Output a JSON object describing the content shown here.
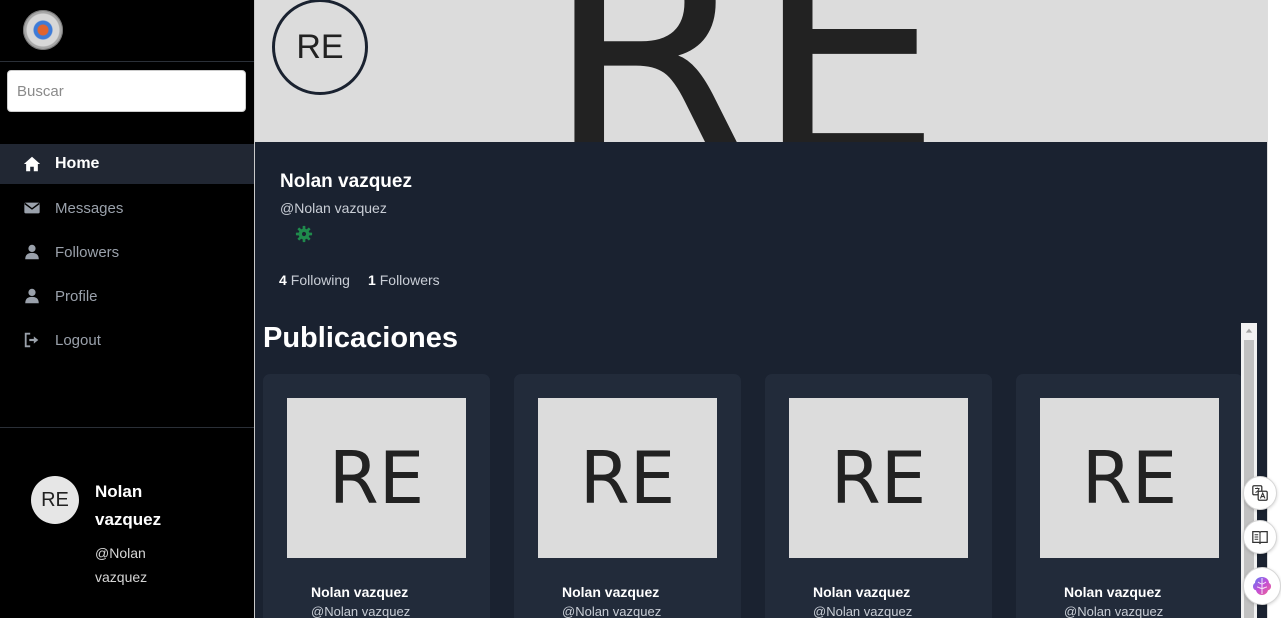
{
  "sidebar": {
    "search_placeholder": "Buscar",
    "nav": [
      {
        "label": "Home",
        "icon": "home-icon"
      },
      {
        "label": "Messages",
        "icon": "envelope-icon"
      },
      {
        "label": "Followers",
        "icon": "user-icon"
      },
      {
        "label": "Profile",
        "icon": "user-icon"
      },
      {
        "label": "Logout",
        "icon": "logout-icon"
      }
    ],
    "user": {
      "initials": "RE",
      "name": "Nolan vazquez",
      "handle": "@Nolan vazquez"
    }
  },
  "profile": {
    "cover_text": "RE",
    "avatar_initials": "RE",
    "name": "Nolan vazquez",
    "handle": "@Nolan vazquez",
    "following_count": "4",
    "following_label": "Following",
    "followers_count": "1",
    "followers_label": "Followers"
  },
  "posts": {
    "title": "Publicaciones",
    "items": [
      {
        "image_text": "RE",
        "name": "Nolan vazquez",
        "handle": "@Nolan vazquez"
      },
      {
        "image_text": "RE",
        "name": "Nolan vazquez",
        "handle": "@Nolan vazquez"
      },
      {
        "image_text": "RE",
        "name": "Nolan vazquez",
        "handle": "@Nolan vazquez"
      },
      {
        "image_text": "RE",
        "name": "Nolan vazquez",
        "handle": "@Nolan vazquez"
      }
    ]
  },
  "colors": {
    "sidebar_bg": "#000000",
    "main_bg": "#1a2230",
    "card_bg": "#222b3a",
    "active_nav_bg": "#212733",
    "settings_icon": "#1f8a4c"
  }
}
